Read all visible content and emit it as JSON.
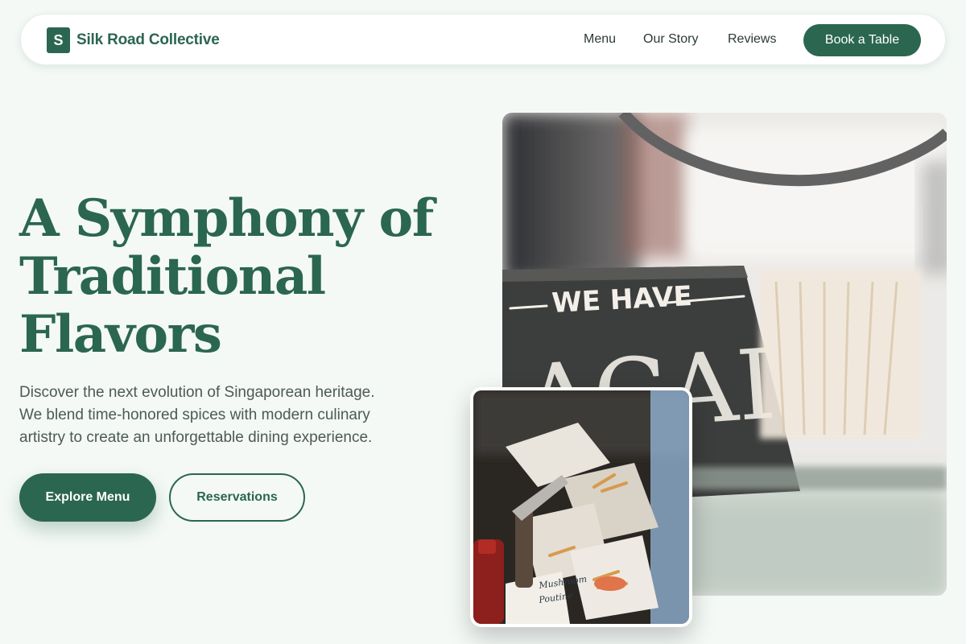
{
  "nav": {
    "logo_letter": "S",
    "brand": "Silk Road Collective",
    "links": [
      "Menu",
      "Our Story",
      "Reviews"
    ],
    "cta": "Book a Table"
  },
  "hero": {
    "headline": [
      "A Symphony of",
      "Traditional",
      "Flavors"
    ],
    "lead": [
      "Discover the next evolution of Singaporean heritage.",
      "We blend time-honored spices with modern culinary",
      "artistry to create an unforgettable dining experience."
    ],
    "primary_button": "Explore Menu",
    "secondary_button": "Reservations"
  },
  "images": {
    "main_sign_text": [
      "WE HAVE",
      "ACAI"
    ],
    "inset_label_text": [
      "Mushroom",
      "Poutine"
    ]
  },
  "colors": {
    "brand": "#2b6650",
    "background": "#f4f9f6",
    "text": "#4d5a54"
  }
}
